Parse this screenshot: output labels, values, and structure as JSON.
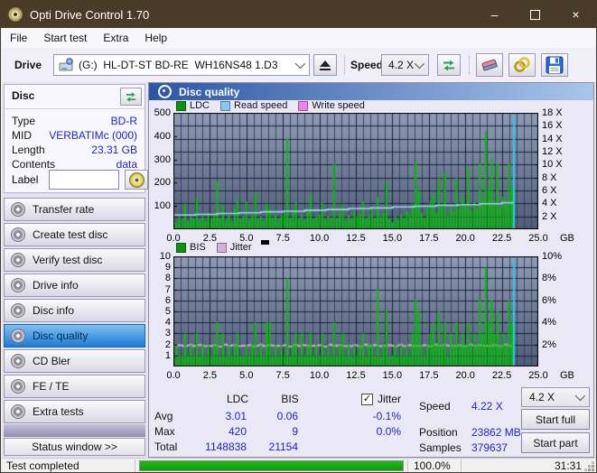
{
  "window": {
    "title": "Opti Drive Control 1.70",
    "minimize": "–",
    "close": "×"
  },
  "menu": [
    "File",
    "Start test",
    "Extra",
    "Help"
  ],
  "toolbar": {
    "drive_label": "Drive",
    "drive_value": "(G:)  HL-DT-ST BD-RE  WH16NS48 1.D3",
    "speed_label": "Speed",
    "speed_value": "4.2 X"
  },
  "sidebar": {
    "panel_title": "Disc",
    "info": [
      {
        "label": "Type",
        "value": "BD-R"
      },
      {
        "label": "MID",
        "value": "VERBATIMc (000)"
      },
      {
        "label": "Length",
        "value": "23.31 GB"
      },
      {
        "label": "Contents",
        "value": "data"
      }
    ],
    "label_field": {
      "label": "Label",
      "value": ""
    },
    "nav": [
      {
        "label": "Transfer rate",
        "selected": false
      },
      {
        "label": "Create test disc",
        "selected": false
      },
      {
        "label": "Verify test disc",
        "selected": false
      },
      {
        "label": "Drive info",
        "selected": false
      },
      {
        "label": "Disc info",
        "selected": false
      },
      {
        "label": "Disc quality",
        "selected": true
      },
      {
        "label": "CD Bler",
        "selected": false
      },
      {
        "label": "FE / TE",
        "selected": false
      },
      {
        "label": "Extra tests",
        "selected": false
      }
    ],
    "status_window_label": "Status window >>"
  },
  "main": {
    "header": "Disc quality"
  },
  "stats": {
    "col_headers": [
      "LDC",
      "BIS"
    ],
    "jitter_label": "Jitter",
    "jitter_checked": true,
    "rows": [
      {
        "label": "Avg",
        "values": [
          "3.01",
          "0.06",
          "-0.1%"
        ]
      },
      {
        "label": "Max",
        "values": [
          "420",
          "9",
          "0.0%"
        ]
      },
      {
        "label": "Total",
        "values": [
          "1148838",
          "21154",
          ""
        ]
      }
    ],
    "right_rows": [
      {
        "label": "Speed",
        "value": "4.22 X"
      },
      {
        "label": "Position",
        "value": "23862 MB"
      },
      {
        "label": "Samples",
        "value": "379637"
      }
    ],
    "speed_select": "4.2 X",
    "buttons": [
      "Start full",
      "Start part"
    ]
  },
  "statusbar": {
    "text": "Test completed",
    "percent": "100.0%",
    "time": "31:31"
  },
  "chart_data": [
    {
      "type": "bar",
      "name": "LDC errors with read speed overlay",
      "x_unit": "GB",
      "x_start": 0,
      "x_step": 0.2,
      "x_max": 25,
      "left_axis": {
        "max": 500,
        "ticks": [
          {
            "v": 500,
            "label": "500"
          },
          {
            "v": 400,
            "label": "400"
          },
          {
            "v": 300,
            "label": "300"
          },
          {
            "v": 200,
            "label": "200"
          },
          {
            "v": 100,
            "label": "100"
          }
        ]
      },
      "right_axis": {
        "max": 18,
        "division": 2,
        "ticks": [
          {
            "v": 18,
            "label": "18 X"
          },
          {
            "v": 16,
            "label": "16 X"
          },
          {
            "v": 14,
            "label": "14 X"
          },
          {
            "v": 12,
            "label": "12 X"
          },
          {
            "v": 10,
            "label": "10 X"
          },
          {
            "v": 8,
            "label": "8 X"
          },
          {
            "v": 6,
            "label": "6 X"
          },
          {
            "v": 4,
            "label": "4 X"
          },
          {
            "v": 2,
            "label": "2 X"
          }
        ]
      },
      "x_ticks": [
        {
          "v": 0,
          "label": "0.0"
        },
        {
          "v": 2.5,
          "label": "2.5"
        },
        {
          "v": 5,
          "label": "5.0"
        },
        {
          "v": 7.5,
          "label": "7.5"
        },
        {
          "v": 10,
          "label": "10.0"
        },
        {
          "v": 12.5,
          "label": "12.5"
        },
        {
          "v": 15,
          "label": "15.0"
        },
        {
          "v": 17.5,
          "label": "17.5"
        },
        {
          "v": 20,
          "label": "20.0"
        },
        {
          "v": 22.5,
          "label": "22.5"
        },
        {
          "v": 25,
          "label": "25.0"
        }
      ],
      "legend": [
        {
          "label": "LDC",
          "color": "#0d930d"
        },
        {
          "label": "Read speed",
          "color": "#85c7f0"
        },
        {
          "label": "Write speed",
          "color": "#ef82e8"
        }
      ],
      "bars": {
        "color": "#00c400",
        "values": [
          45,
          30,
          55,
          40,
          110,
          35,
          60,
          45,
          130,
          40,
          55,
          35,
          70,
          45,
          60,
          205,
          50,
          100,
          40,
          60,
          35,
          90,
          130,
          45,
          55,
          120,
          40,
          60,
          160,
          45,
          55,
          35,
          110,
          90,
          50,
          65,
          40,
          55,
          70,
          390,
          50,
          80,
          120,
          45,
          60,
          40,
          75,
          150,
          45,
          55,
          65,
          120,
          40,
          60,
          50,
          285,
          45,
          70,
          110,
          40,
          60,
          45,
          80,
          55,
          65,
          120,
          45,
          60,
          90,
          50,
          140,
          55,
          70,
          200,
          45,
          30,
          55,
          40,
          65,
          50,
          80,
          60,
          110,
          290,
          165,
          70,
          50,
          90,
          120,
          160,
          70,
          220,
          90,
          250,
          60,
          110,
          75,
          220,
          90,
          140,
          110,
          270,
          80,
          120,
          90,
          280,
          130,
          420,
          170,
          305,
          120,
          280,
          95,
          140,
          110,
          280,
          180
        ]
      },
      "line": {
        "axis": "right",
        "color": "#9fd4f5",
        "points": [
          [
            0,
            2.2
          ],
          [
            1.5,
            2.3
          ],
          [
            3,
            2.45
          ],
          [
            4.5,
            2.55
          ],
          [
            6,
            2.7
          ],
          [
            7.5,
            2.8
          ],
          [
            9,
            2.95
          ],
          [
            10.5,
            3.05
          ],
          [
            12,
            3.2
          ],
          [
            13.5,
            3.3
          ],
          [
            15,
            3.45
          ],
          [
            16.5,
            3.55
          ],
          [
            18,
            3.7
          ],
          [
            19.5,
            3.8
          ],
          [
            21,
            3.95
          ],
          [
            22.5,
            4.1
          ],
          [
            23.35,
            4.25
          ]
        ]
      },
      "end_line": {
        "x": 23.35,
        "color": "#25c8f6"
      }
    },
    {
      "type": "bar",
      "name": "BIS errors with jitter overlay",
      "x_unit": "GB",
      "x_start": 0,
      "x_step": 0.2,
      "x_max": 25,
      "left_axis": {
        "max": 10,
        "ticks": [
          {
            "v": 10,
            "label": "10"
          },
          {
            "v": 9,
            "label": "9"
          },
          {
            "v": 8,
            "label": "8"
          },
          {
            "v": 7,
            "label": "7"
          },
          {
            "v": 6,
            "label": "6"
          },
          {
            "v": 5,
            "label": "5"
          },
          {
            "v": 4,
            "label": "4"
          },
          {
            "v": 3,
            "label": "3"
          },
          {
            "v": 2,
            "label": "2"
          },
          {
            "v": 1,
            "label": "1"
          }
        ]
      },
      "right_axis": {
        "max": 10,
        "division": 1,
        "ticks": [
          {
            "v": 10,
            "label": "10%"
          },
          {
            "v": 8,
            "label": "8%"
          },
          {
            "v": 6,
            "label": "6%"
          },
          {
            "v": 4,
            "label": "4%"
          },
          {
            "v": 2,
            "label": "2%"
          }
        ]
      },
      "x_ticks": [
        {
          "v": 0,
          "label": "0.0"
        },
        {
          "v": 2.5,
          "label": "2.5"
        },
        {
          "v": 5,
          "label": "5.0"
        },
        {
          "v": 7.5,
          "label": "7.5"
        },
        {
          "v": 10,
          "label": "10.0"
        },
        {
          "v": 12.5,
          "label": "12.5"
        },
        {
          "v": 15,
          "label": "15.0"
        },
        {
          "v": 17.5,
          "label": "17.5"
        },
        {
          "v": 20,
          "label": "20.0"
        },
        {
          "v": 22.5,
          "label": "22.5"
        },
        {
          "v": 25,
          "label": "25.0"
        }
      ],
      "legend": [
        {
          "label": "BIS",
          "color": "#0d930d"
        },
        {
          "label": "Jitter",
          "color": "#d4afd8"
        }
      ],
      "bars": {
        "color": "#00c400",
        "values": [
          1,
          2,
          1,
          1,
          3,
          1,
          2,
          1,
          3,
          1,
          2,
          1,
          2,
          1,
          2,
          4,
          1,
          3,
          1,
          2,
          1,
          2,
          3,
          1,
          1,
          2,
          1,
          2,
          4,
          1,
          2,
          1,
          4,
          4,
          1,
          2,
          1,
          2,
          1,
          8,
          1,
          2,
          3,
          1,
          3,
          1,
          2,
          3,
          1,
          2,
          1,
          3,
          1,
          2,
          1,
          4,
          1,
          2,
          3,
          1,
          2,
          1,
          2,
          1,
          2,
          3,
          1,
          2,
          2,
          1,
          7,
          1,
          2,
          5,
          1,
          1,
          2,
          1,
          2,
          1,
          2,
          1,
          3,
          6,
          5,
          2,
          1,
          2,
          3,
          4,
          2,
          5,
          2,
          4,
          1,
          3,
          2,
          4,
          2,
          3,
          2,
          4,
          2,
          3,
          2,
          6,
          3,
          9,
          4,
          6,
          3,
          5,
          2,
          3,
          2,
          6,
          4
        ]
      },
      "jitter": {
        "color": "#cfa9d4",
        "values": [
          1.9,
          1.85,
          1.95,
          1.9,
          1.8,
          1.9,
          2.0,
          1.85,
          1.9,
          1.95,
          1.9,
          1.85,
          1.9,
          1.85,
          1.95,
          1.9,
          1.8,
          1.9,
          2.0,
          1.85,
          1.9,
          1.95,
          1.9,
          1.85,
          1.9,
          1.85,
          1.95,
          1.9,
          1.8,
          1.9,
          2.0,
          1.85,
          1.9,
          1.95,
          1.9,
          1.85,
          1.9,
          1.85,
          1.95,
          1.9,
          1.8,
          1.9,
          2.0,
          1.85,
          1.9,
          1.95,
          1.9,
          1.85,
          1.9,
          1.85,
          1.95,
          1.9,
          1.8,
          1.9,
          2.0,
          1.85,
          1.9,
          1.95,
          1.9,
          1.85,
          1.9,
          1.85,
          1.95,
          1.9,
          1.8,
          1.9,
          2.0,
          1.85,
          1.9,
          1.95,
          1.9,
          1.85,
          1.9,
          1.85,
          1.95,
          1.9,
          1.8,
          1.9,
          2.0,
          1.85,
          1.9,
          1.95,
          1.9,
          1.85,
          1.9,
          1.85,
          1.95,
          1.9,
          1.8,
          1.9,
          2.0,
          1.85,
          1.9,
          1.95,
          1.9,
          1.85,
          1.9,
          1.85,
          1.95,
          1.9,
          1.8,
          1.9,
          2.0,
          1.85,
          1.9,
          1.95,
          1.9,
          1.85,
          1.9,
          1.85,
          1.95,
          1.9,
          1.8,
          1.9,
          2.0,
          1.85,
          1.9
        ]
      },
      "end_line": {
        "x": 23.35,
        "color": "#25c8f6"
      }
    }
  ]
}
